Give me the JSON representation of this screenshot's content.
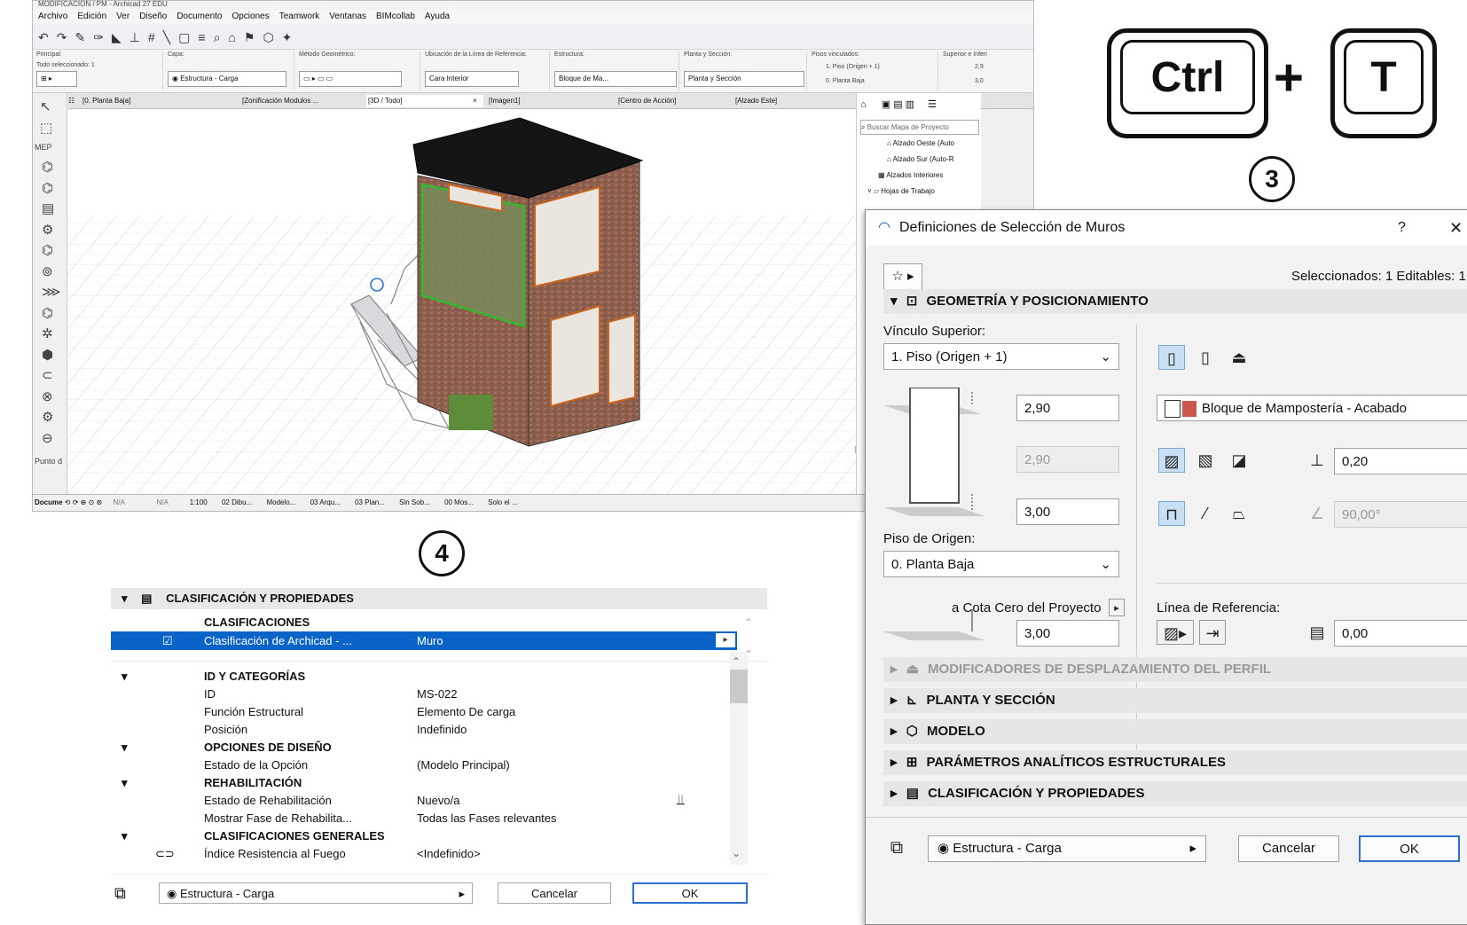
{
  "archicad": {
    "title": "MODIFICACIÓN / PM - Archicad 27 EDU",
    "menu": [
      "Archivo",
      "Edición",
      "Ver",
      "Diseño",
      "Documento",
      "Opciones",
      "Teamwork",
      "Ventanas",
      "BIMcollab",
      "Ayuda"
    ],
    "infobox": {
      "principal_label": "Principal:",
      "principal_value": "Todo seleccionado: 1",
      "capa_label": "Capa:",
      "capa_value": "Estructura - Carga",
      "metodo_label": "Método Geométrico:",
      "ubicacion_label": "Ubicación de la Línea de Referencia:",
      "ubicacion_value": "Cara Interior",
      "estructura_label": "Estructura:",
      "estructura_value": "Bloque de Ma...",
      "planta_label": "Planta y Sección:",
      "planta_value": "Planta y Sección",
      "pisos_label": "Pisos vinculados:",
      "piso_sup": "1. Piso (Origen + 1)",
      "piso_inf": "0. Planta Baja",
      "superior_label": "Superior e Inferi",
      "superior_value_1": "2,9",
      "superior_value_2": "3,0"
    },
    "tabs": [
      "[0. Planta Baja]",
      "[Zonificación Modulos ...",
      "[3D / Todo]",
      "[Imagen1]",
      "[Centro de Acción]",
      "[Alzado Este]"
    ],
    "toolbox": {
      "mep_label": "MEP",
      "punto_label": "Punto d",
      "docume_label": "Docume"
    },
    "navigator": {
      "search_placeholder": "Buscar Mapa de Proyecto",
      "items": [
        "Alzado Oeste (Auto",
        "Alzado Sur (Auto-R",
        "Alzados Interiores",
        "Hojas de Trabajo"
      ]
    },
    "statusbar": [
      "N/A",
      "N/A",
      "1:100",
      "02 Dibu...",
      "Modelo...",
      "03 Arqu...",
      "03 Plan...",
      "Sin Sob...",
      "00 Mos...",
      "Solo el ..."
    ]
  },
  "shortcut": {
    "key1": "Ctrl",
    "plus": "+",
    "key2": "T",
    "step": "3"
  },
  "step4": "4",
  "wall_dialog": {
    "title": "Definiciones de Selección de Muros",
    "help": "?",
    "close": "✕",
    "selected_info": "Seleccionados: 1 Editables: 1",
    "geo_section": "GEOMETRÍA Y POSICIONAMIENTO",
    "vinculo_label": "Vínculo Superior:",
    "vinculo_value": "1. Piso (Origen + 1)",
    "height_top": "2,90",
    "height_mid": "2,90",
    "height_bottom": "3,00",
    "piso_origen_label": "Piso de Origen:",
    "piso_origen_value": "0. Planta Baja",
    "cota_label": "a Cota Cero del Proyecto",
    "cota_value": "3,00",
    "material": "Bloque de Mampostería - Acabado",
    "thickness": "0,20",
    "angle": "90,00°",
    "linea_label": "Línea de Referencia:",
    "offset": "0,00",
    "sections": [
      "MODIFICADORES DE DESPLAZAMIENTO DEL PERFIL",
      "PLANTA Y SECCIÓN",
      "MODELO",
      "PARÁMETROS ANALÍTICOS ESTRUCTURALES",
      "CLASIFICACIÓN Y PROPIEDADES"
    ],
    "layer": "Estructura - Carga",
    "cancel": "Cancelar",
    "ok": "OK"
  },
  "class_panel": {
    "section": "CLASIFICACIÓN Y PROPIEDADES",
    "clasificaciones": "CLASIFICACIONES",
    "class_row_name": "Clasificación de Archicad - ...",
    "class_row_value": "Muro",
    "id_group": "ID Y CATEGORÍAS",
    "rows1": [
      {
        "name": "ID",
        "value": "MS-022"
      },
      {
        "name": "Función Estructural",
        "value": "Elemento De carga"
      },
      {
        "name": "Posición",
        "value": "Indefinido"
      }
    ],
    "opciones_group": "OPCIONES DE DISEÑO",
    "opcion_name": "Estado de la Opción",
    "opcion_value": "(Modelo Principal)",
    "rehab_group": "REHABILITACIÓN",
    "rehab_rows": [
      {
        "name": "Estado de Rehabilitación",
        "value": "Nuevo/a"
      },
      {
        "name": "Mostrar Fase de Rehabilita...",
        "value": "Todas las Fases relevantes"
      }
    ],
    "generales_group": "CLASIFICACIONES GENERALES",
    "fuego_name": "Índice Resistencia al Fuego",
    "fuego_value": "<Indefinido>",
    "layer": "Estructura - Carga",
    "cancel": "Cancelar",
    "ok": "OK"
  },
  "colors": {
    "accent": "#0a64c8",
    "selection": "#0a64c8",
    "wall_brick": "#9a6a55",
    "roof": "#111111",
    "grid": "#b9c7dd"
  }
}
